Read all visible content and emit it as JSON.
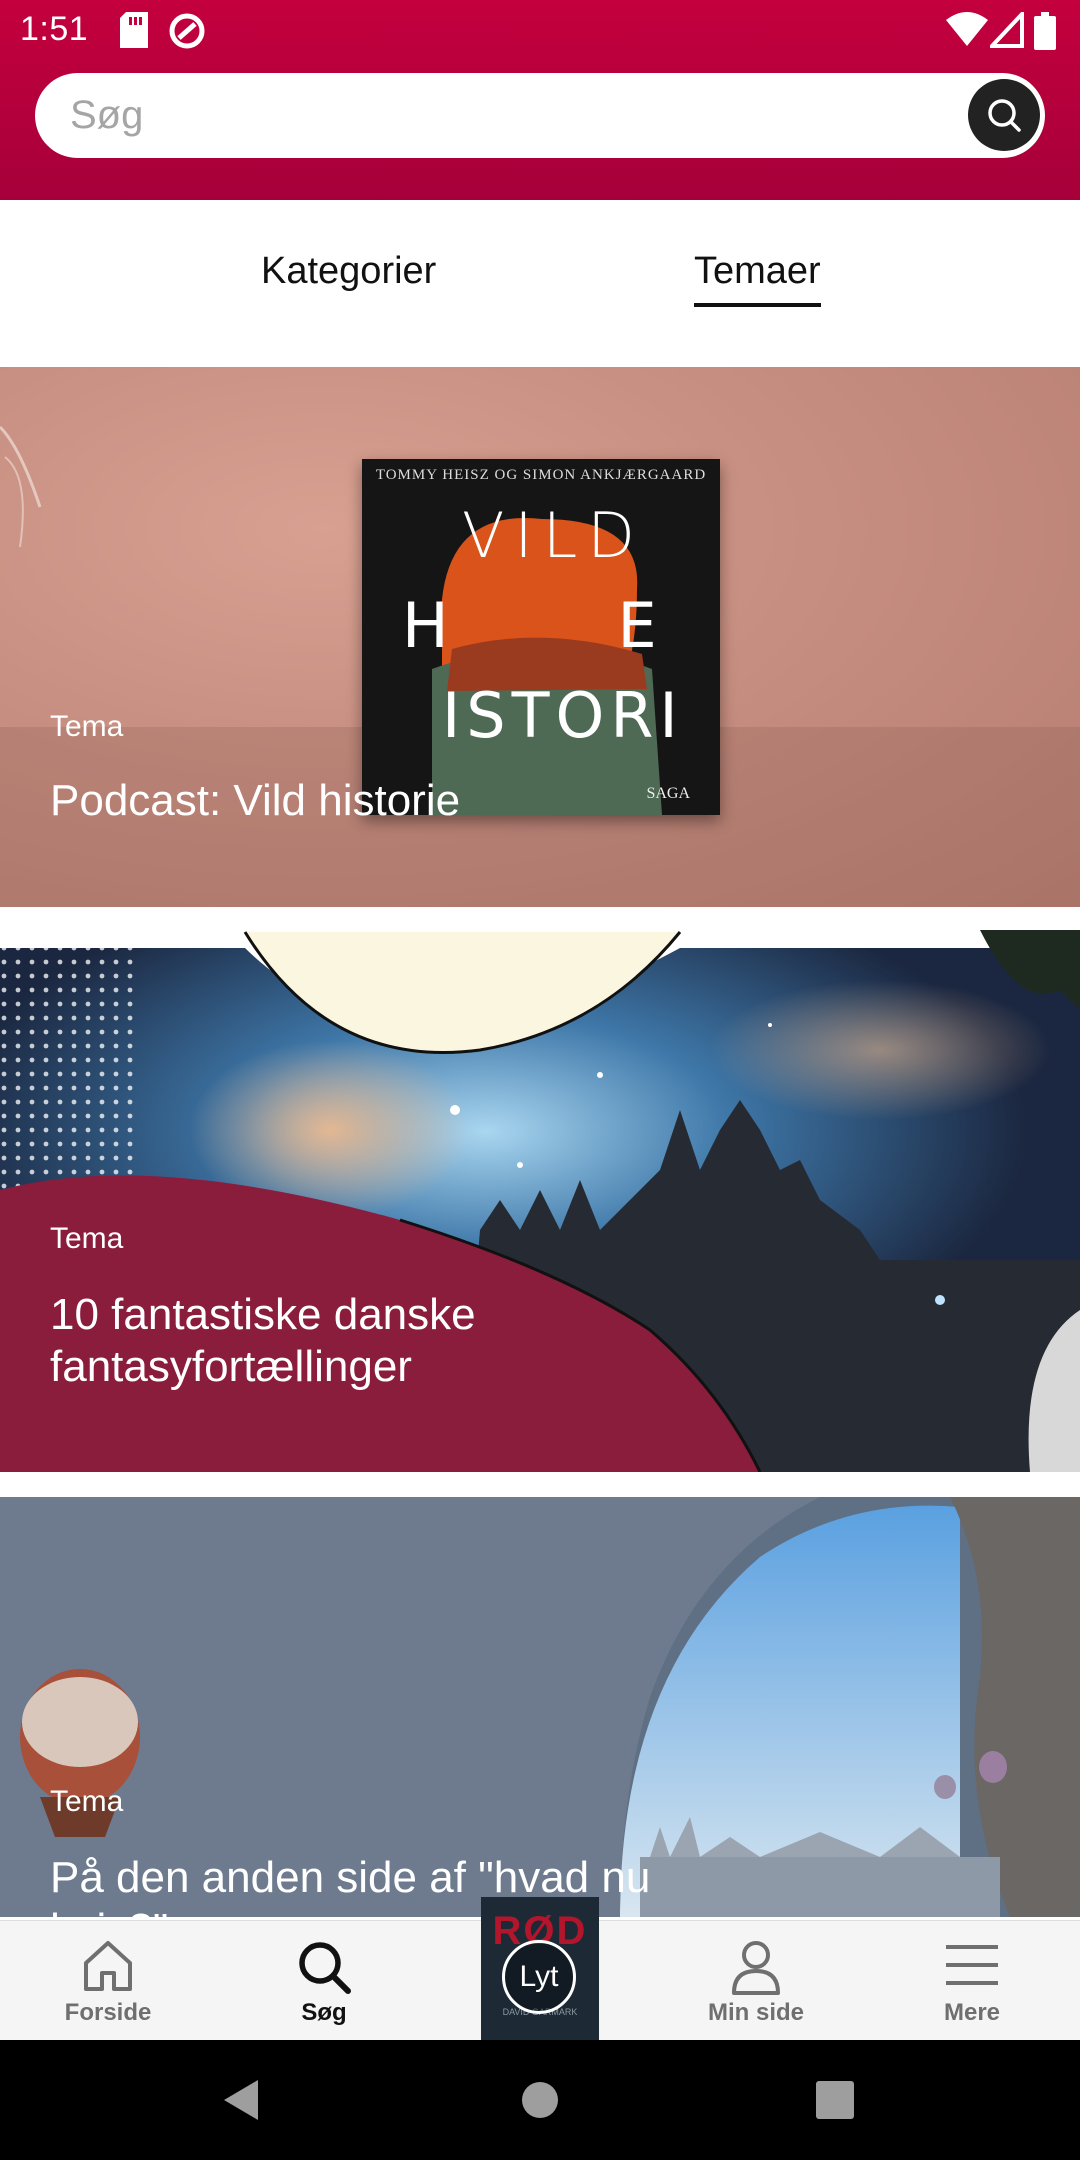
{
  "status": {
    "time": "1:51"
  },
  "search": {
    "placeholder": "Søg"
  },
  "tabs": [
    {
      "label": "Kategorier",
      "active": false
    },
    {
      "label": "Temaer",
      "active": true
    }
  ],
  "cards": [
    {
      "label": "Tema",
      "title": "Podcast: Vild historie",
      "cover": {
        "authors": "TOMMY HEISZ OG SIMON ANKJÆRGAARD",
        "line1": "VILD",
        "line2": "H    E",
        "line3": "ISTORI",
        "publisher": "SAGA"
      }
    },
    {
      "label": "Tema",
      "title": "10 fantastiske danske fantasyfortællinger"
    },
    {
      "label": "Tema",
      "title": "På den anden side af \"hvad nu hvis?\""
    }
  ],
  "bottom_nav": [
    {
      "label": "Forside",
      "icon": "home-icon",
      "active": false
    },
    {
      "label": "Søg",
      "icon": "search-icon",
      "active": true
    },
    {
      "label": "Min side",
      "icon": "person-icon",
      "active": false
    },
    {
      "label": "Mere",
      "icon": "menu-icon",
      "active": false
    }
  ],
  "player": {
    "label": "Lyt",
    "cover_title": "RØD",
    "cover_author": "DAVID GARMARK"
  },
  "colors": {
    "brand": "#c4003e",
    "accent_dark": "#222222"
  }
}
